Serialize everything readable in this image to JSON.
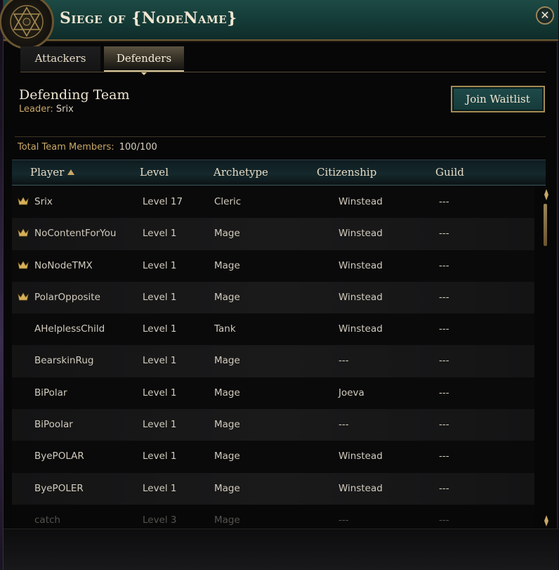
{
  "header": {
    "title": "Siege of {NodeName}",
    "close_label": "✕"
  },
  "tabs": [
    {
      "label": "Attackers",
      "active": false
    },
    {
      "label": "Defenders",
      "active": true
    }
  ],
  "team": {
    "title": "Defending Team",
    "leader_label": "Leader:",
    "leader_name": "Srix",
    "join_button": "Join Waitlist",
    "total_label": "Total Team Members:",
    "total_value": "100/100"
  },
  "table": {
    "columns": {
      "player": "Player",
      "level": "Level",
      "archetype": "Archetype",
      "citizenship": "Citizenship",
      "guild": "Guild"
    },
    "rows": [
      {
        "player": "Srix",
        "level": "Level 17",
        "archetype": "Cleric",
        "citizenship": "Winstead",
        "guild": "---"
      },
      {
        "player": "NoContentForYou",
        "level": "Level 1",
        "archetype": "Mage",
        "citizenship": "Winstead",
        "guild": "---"
      },
      {
        "player": "NoNodeTMX",
        "level": "Level 1",
        "archetype": "Mage",
        "citizenship": "Winstead",
        "guild": "---"
      },
      {
        "player": "PolarOpposite",
        "level": "Level 1",
        "archetype": "Mage",
        "citizenship": "Winstead",
        "guild": "---"
      },
      {
        "player": "AHelplessChild",
        "level": "Level 1",
        "archetype": "Tank",
        "citizenship": "Winstead",
        "guild": "---"
      },
      {
        "player": "BearskinRug",
        "level": "Level 1",
        "archetype": "Mage",
        "citizenship": "---",
        "guild": "---"
      },
      {
        "player": "BiPolar",
        "level": "Level 1",
        "archetype": "Mage",
        "citizenship": "Joeva",
        "guild": "---"
      },
      {
        "player": "BiPoolar",
        "level": "Level 1",
        "archetype": "Mage",
        "citizenship": "---",
        "guild": "---"
      },
      {
        "player": "ByePOLAR",
        "level": "Level 1",
        "archetype": "Mage",
        "citizenship": "Winstead",
        "guild": "---"
      },
      {
        "player": "ByePOLER",
        "level": "Level 1",
        "archetype": "Mage",
        "citizenship": "Winstead",
        "guild": "---"
      },
      {
        "player": "catch",
        "level": "Level 3",
        "archetype": "Mage",
        "citizenship": "---",
        "guild": "---"
      }
    ]
  },
  "colors": {
    "accent_gold": "#c9a866",
    "header_teal": "#1d4a44",
    "button_teal": "#1f4a4a"
  },
  "icons": {
    "crown": "crown-icon",
    "emblem": "hexagram-emblem-icon",
    "close": "close-icon"
  }
}
